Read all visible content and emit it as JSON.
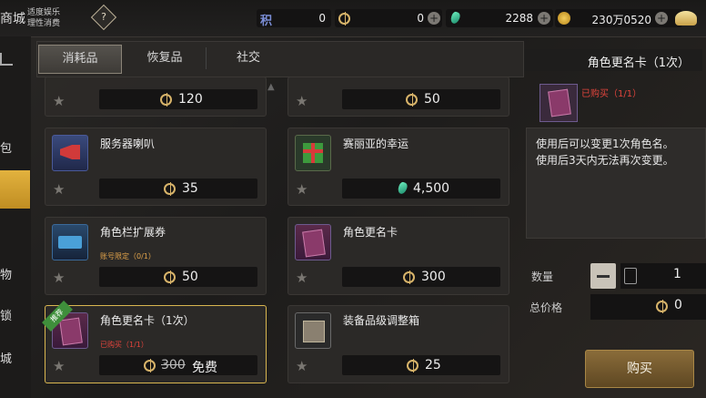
{
  "header": {
    "title_fragment": "商城",
    "note_line1": "适度娱乐",
    "note_line2": "理性消费",
    "help_glyph": "?",
    "currencies": [
      {
        "icon": "points-icon",
        "label": "积",
        "value": "0"
      },
      {
        "icon": "coin-icon",
        "value": "0"
      },
      {
        "icon": "gem-icon",
        "value": "2288"
      },
      {
        "icon": "gold-coin-icon",
        "value": "230万0520"
      }
    ]
  },
  "sidebar": {
    "items": [
      "包",
      "物",
      "锁",
      "城"
    ]
  },
  "tabs": [
    {
      "label": "消耗品",
      "active": true
    },
    {
      "label": "恢复品",
      "active": false
    },
    {
      "label": "社交",
      "active": false
    }
  ],
  "items": [
    {
      "name": "",
      "price": "120",
      "currency": "coin"
    },
    {
      "name": "",
      "price": "50",
      "currency": "coin"
    },
    {
      "name": "服务器喇叭",
      "price": "35",
      "currency": "coin"
    },
    {
      "name": "赛丽亚的幸运",
      "price": "4,500",
      "currency": "gem"
    },
    {
      "name": "角色栏扩展券",
      "limit": "账号限定（0/1）",
      "price": "50",
      "currency": "coin"
    },
    {
      "name": "角色更名卡",
      "price": "300",
      "currency": "coin"
    },
    {
      "name": "角色更名卡（1次）",
      "limit": "已购买（1/1）",
      "badge": "推荐",
      "old_price": "300",
      "price": "免费",
      "currency": "coin",
      "selected": true
    },
    {
      "name": "装备品级调整箱",
      "price": "25",
      "currency": "coin"
    }
  ],
  "detail": {
    "title": "角色更名卡（1次）",
    "purchased": "已购买（1/1）",
    "desc_line1": "使用后可以变更1次角色名。",
    "desc_line2": "使用后3天内无法再次变更。",
    "qty_label": "数量",
    "qty_value": "1",
    "total_label": "总价格",
    "total_value": "0",
    "buy_label": "购买"
  },
  "colors": {
    "accent": "#d9b650",
    "buy": "#8a6c3a",
    "limit": "#e0a24a"
  }
}
